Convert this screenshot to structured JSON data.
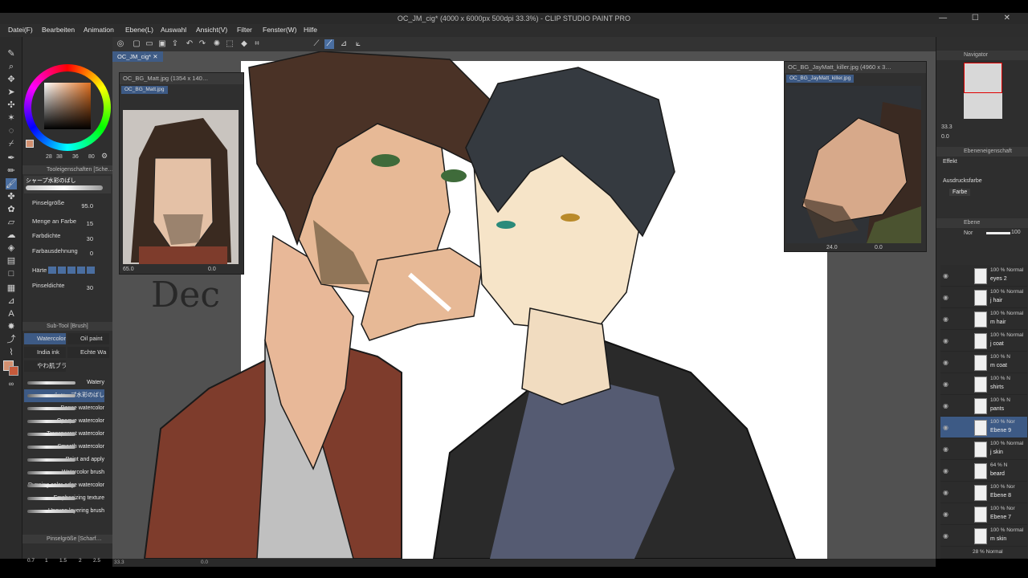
{
  "window": {
    "title": "OC_JM_cig* (4000 x 6000px 500dpi 33.3%) - CLIP STUDIO PAINT PRO",
    "controls": [
      "—",
      "☐",
      "✕"
    ]
  },
  "menu": [
    "Datei(F)",
    "Bearbeiten",
    "Animation",
    "Ebene(L)",
    "Auswahl",
    "Ansicht(V)",
    "Filter",
    "Fenster(W)",
    "Hilfe"
  ],
  "document": {
    "tab": "OC_JM_cig*",
    "tab_close": "✕"
  },
  "color_wheel": {
    "values": [
      "28",
      "38",
      "36",
      "80"
    ]
  },
  "tool_property": {
    "header": "Tooleigenschaften [Sche…",
    "brush_name": "シャープ水彩のばし",
    "rows": [
      {
        "label": "Pinselgröße",
        "value": "95.0"
      },
      {
        "label": "Menge an Farbe",
        "value": "15"
      },
      {
        "label": "Farbdichte",
        "value": "30"
      },
      {
        "label": "Farbausdehnung",
        "value": "0"
      },
      {
        "label": "Härte",
        "value": ""
      },
      {
        "label": "Pinseldichte",
        "value": "30"
      }
    ]
  },
  "sub_tool": {
    "header": "Sub-Tool [Brush]",
    "tabs": [
      "Watercolor",
      "Oil paint",
      "India ink",
      "Echte Wa",
      "やわ肌ブラ"
    ],
    "brushes": [
      "Watery",
      "シャープ水彩のばし",
      "Dense watercolor",
      "Opaque watercolor",
      "Transparent watercolor",
      "Smooth watercolor",
      "Paint and apply",
      "Watercolor brush",
      "Running color edge watercolor",
      "Emphasizing texture",
      "Uneven layering brush"
    ],
    "footer": "Pinselgröße [Scharf…",
    "sizes": [
      "0.7",
      "1",
      "1.5",
      "2",
      "2.5"
    ]
  },
  "ref_left": {
    "title": "OC_BG_Matt.jpg (1354 x 140…",
    "tab": "OC_BG_Matt.jpg",
    "zoom": "65.0",
    "rotation": "0.0"
  },
  "ref_right": {
    "title": "OC_BG_JayMatt_killer.jpg (4960 x 3…",
    "tab": "OC_BG_JayMatt_killer.jpg",
    "zoom": "24.0",
    "rotation": "0.0"
  },
  "navigator": {
    "header": "Navigator",
    "zoom": "33.3",
    "rotation": "0.0"
  },
  "layer_property": {
    "header": "Ebeneneigenschaft",
    "effect_label": "Effekt",
    "expr_color_label": "Ausdrucksfarbe",
    "expr_color_value": "Farbe"
  },
  "layers_panel": {
    "header": "Ebene",
    "blend": "Nor",
    "opacity": "100",
    "layers": [
      {
        "mode": "100 % Normal",
        "name": "eyes 2",
        "selected": false
      },
      {
        "mode": "100 % Normal",
        "name": "j hair",
        "selected": false
      },
      {
        "mode": "100 % Normal",
        "name": "m hair",
        "selected": false
      },
      {
        "mode": "100 % Normal",
        "name": "j coat",
        "selected": false
      },
      {
        "mode": "100 % N",
        "name": "m coat",
        "selected": false
      },
      {
        "mode": "100 % N",
        "name": "shirts",
        "selected": false
      },
      {
        "mode": "100 % N",
        "name": "pants",
        "selected": false
      },
      {
        "mode": "100 % Nor",
        "name": "Ebene 9",
        "selected": true
      },
      {
        "mode": "100 % Normal",
        "name": "j skin",
        "selected": false
      },
      {
        "mode": "64 % N",
        "name": "beard",
        "selected": false
      },
      {
        "mode": "100 % Nor",
        "name": "Ebene 8",
        "selected": false
      },
      {
        "mode": "100 % Nor",
        "name": "Ebene 7",
        "selected": false
      },
      {
        "mode": "100 % Normal",
        "name": "m skin",
        "selected": false
      },
      {
        "mode": "28 % Normal",
        "name": "",
        "selected": false
      }
    ]
  },
  "status": {
    "zoom": "33.3",
    "rotation": "0.0"
  },
  "colors": {
    "accent": "#3d5a85",
    "main_color": "#d29070",
    "panel": "#2f2f2f",
    "canvas_bg": "#515151"
  }
}
